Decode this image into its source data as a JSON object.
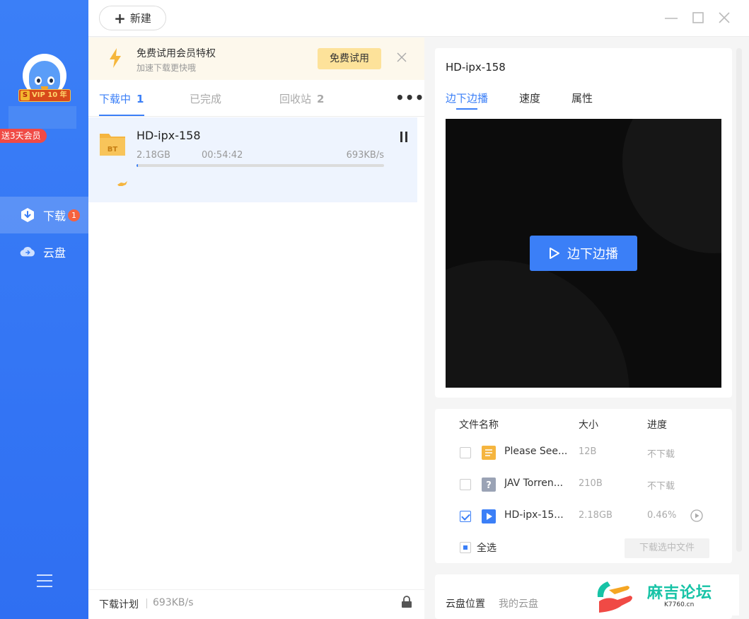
{
  "sidebar": {
    "vip_badge": "VIP 10 年",
    "vip_badge_letter": "S",
    "promo_tag": "送3天会员",
    "nav": [
      {
        "label": "下载",
        "badge": "1",
        "icon": "download-icon"
      },
      {
        "label": "云盘",
        "icon": "cloud-icon"
      }
    ]
  },
  "toolbar": {
    "new_label": "新建"
  },
  "trial": {
    "title": "免费试用会员特权",
    "subtitle": "加速下载更快哦",
    "button": "免费试用"
  },
  "tabs": [
    {
      "label": "下载中",
      "count": "1",
      "active": true
    },
    {
      "label": "已完成",
      "count": "",
      "active": false
    },
    {
      "label": "回收站",
      "count": "2",
      "active": false
    }
  ],
  "more_label": "•••",
  "task": {
    "name": "HD-ipx-158",
    "size": "2.18GB",
    "time_left": "00:54:42",
    "speed": "693KB/s",
    "progress": 0.0046,
    "icon_label": "BT"
  },
  "plan": {
    "label": "下载计划",
    "speed": "693KB/s"
  },
  "detail": {
    "title": "HD-ipx-158",
    "tabs": [
      "边下边播",
      "速度",
      "属性"
    ],
    "play_button": "边下边播"
  },
  "files": {
    "headers": {
      "name": "文件名称",
      "size": "大小",
      "progress": "进度"
    },
    "rows": [
      {
        "name": "Please See...",
        "size": "12B",
        "progress": "不下载",
        "checked": false,
        "icon": "document-icon"
      },
      {
        "name": "JAV Torren...",
        "size": "210B",
        "progress": "不下载",
        "checked": false,
        "icon": "unknown-file-icon"
      },
      {
        "name": "HD-ipx-15...",
        "size": "2.18GB",
        "progress": "0.46%",
        "checked": true,
        "icon": "video-file-icon"
      }
    ],
    "select_all": "全选",
    "download_selected": "下载选中文件"
  },
  "cloud": {
    "label": "云盘位置",
    "value": "我的云盘"
  },
  "watermark": {
    "text": "麻吉论坛",
    "url": "K7760.cn"
  },
  "colors": {
    "accent": "#3b7ff7",
    "sidebar": "#2f6ff2",
    "badge": "#f5623f",
    "trial_bg": "#fdf8ec",
    "trial_button": "#fde29a"
  }
}
